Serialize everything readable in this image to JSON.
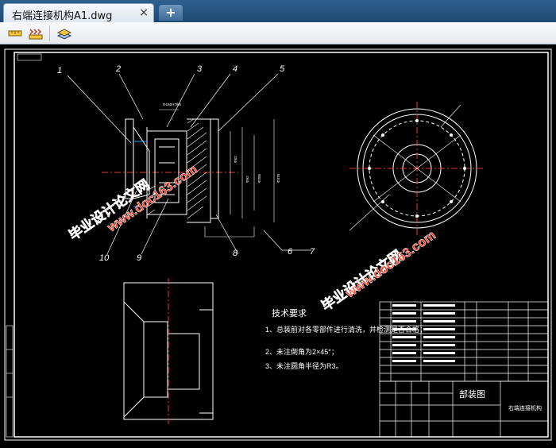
{
  "tabs": {
    "active_title": "右端连接机构A1.dwg",
    "close_glyph": "×",
    "add_glyph": "+"
  },
  "toolbar": {
    "buttons": [
      {
        "name": "measure-icon"
      },
      {
        "name": "dimension-icon"
      },
      {
        "name": "layers-icon"
      }
    ]
  },
  "drawing": {
    "leaders": [
      "1",
      "2",
      "3",
      "4",
      "5",
      "10",
      "9",
      "8",
      "6",
      "7"
    ],
    "tech_title": "技术要求",
    "tech_lines": [
      "1、总装前对各零部件进行清洗，并检测是否合格；",
      "2、未注倒角为2×45°；",
      "3、未注圆角半径为R3。"
    ],
    "title_block": {
      "drawing_type": "部装图",
      "name": "右端连接机构"
    },
    "watermarks": [
      "毕业设计论文网",
      "www.doc163.com"
    ]
  }
}
